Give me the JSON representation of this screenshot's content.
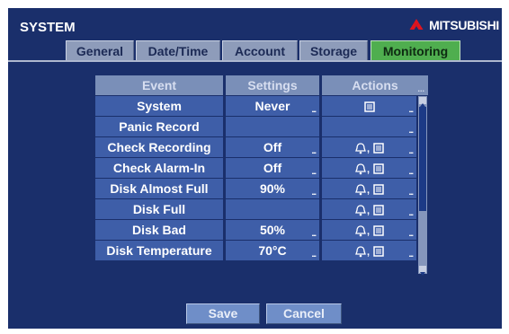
{
  "window": {
    "title": "SYSTEM",
    "brand": "MITSUBISHI"
  },
  "tabs": [
    "General",
    "Date/Time",
    "Account",
    "Storage",
    "Monitoring"
  ],
  "active_tab": "Monitoring",
  "table": {
    "headers": [
      "Event",
      "Settings",
      "Actions"
    ],
    "rows": [
      {
        "event": "System",
        "setting": "Never",
        "actions": "doc-icon"
      },
      {
        "event": "Panic Record",
        "setting": "",
        "actions": ""
      },
      {
        "event": "Check Recording",
        "setting": "Off",
        "actions": "bell-doc-icons"
      },
      {
        "event": "Check Alarm-In",
        "setting": "Off",
        "actions": "bell-doc-icons"
      },
      {
        "event": "Disk Almost Full",
        "setting": "90%",
        "actions": "bell-doc-icons"
      },
      {
        "event": "Disk Full",
        "setting": "",
        "actions": "bell-doc-icons"
      },
      {
        "event": "Disk Bad",
        "setting": "50%",
        "actions": "bell-doc-icons"
      },
      {
        "event": "Disk Temperature",
        "setting": "70°C",
        "actions": "bell-doc-icons"
      }
    ],
    "more_indicator": "..."
  },
  "buttons": {
    "save": "Save",
    "cancel": "Cancel"
  },
  "colors": {
    "background": "#1a2f6b",
    "active_tab": "#4fae4f",
    "cell": "#3e5ea8",
    "header": "#7a8fb8"
  }
}
